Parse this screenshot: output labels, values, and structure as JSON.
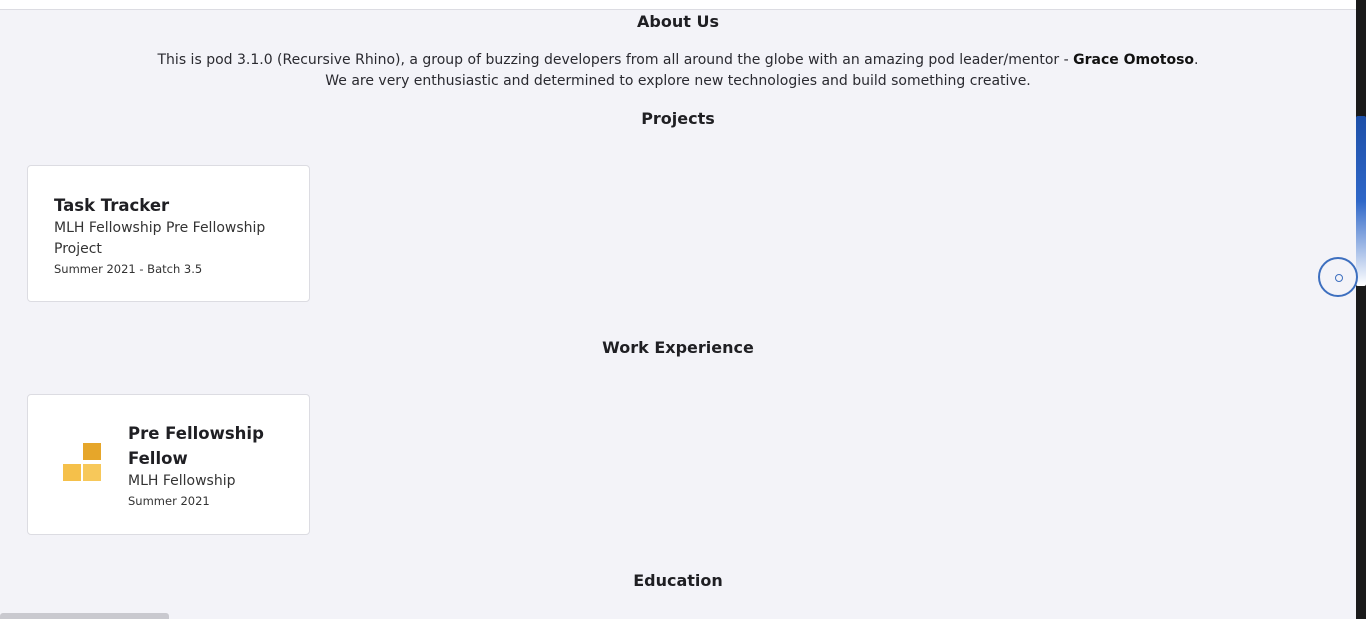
{
  "about": {
    "title": "About Us",
    "line1_prefix": "This is pod 3.1.0 (Recursive Rhino), a group of buzzing developers from all around the globe with an amazing pod leader/mentor - ",
    "mentor": "Grace Omotoso",
    "line1_suffix": ".",
    "line2": "We are very enthusiastic and determined to explore new technologies and build something creative."
  },
  "projects": {
    "title": "Projects",
    "items": [
      {
        "title": "Task Tracker",
        "subtitle": "MLH Fellowship Pre Fellowship Project",
        "date": "Summer 2021 - Batch 3.5"
      }
    ]
  },
  "work": {
    "title": "Work Experience",
    "items": [
      {
        "title": "Pre Fellowship Fellow",
        "company": "MLH Fellowship",
        "date": "Summer 2021",
        "logo_icon": "mlh-fellowship-logo",
        "logo_colors": [
          "#e6a62a",
          "#f5c04a",
          "#f7c85a"
        ]
      }
    ]
  },
  "education": {
    "title": "Education"
  },
  "colors": {
    "background": "#f3f3f8",
    "card": "#ffffff",
    "accent": "#3d6fbf"
  },
  "fab": {
    "icon": "circle-icon"
  }
}
